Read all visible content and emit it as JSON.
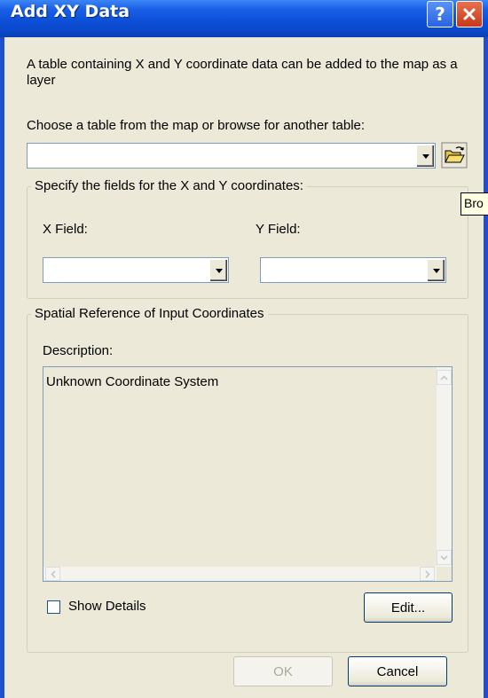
{
  "window": {
    "title": "Add XY Data"
  },
  "description": "A table containing X and Y coordinate data can be added to the map as a layer",
  "table_chooser": {
    "label": "Choose a table from the map or browse for another table:",
    "value": ""
  },
  "fields_group": {
    "legend": "Specify the fields for the X and Y coordinates:",
    "x_label": "X Field:",
    "y_label": "Y Field:",
    "x_value": "",
    "y_value": ""
  },
  "spatial_group": {
    "legend": "Spatial Reference of Input Coordinates",
    "description_label": "Description:",
    "description_text": "Unknown Coordinate System",
    "show_details_label": "Show Details",
    "show_details_checked": false,
    "edit_label": "Edit..."
  },
  "buttons": {
    "ok": "OK",
    "cancel": "Cancel"
  },
  "tooltip": {
    "text": "Bro"
  },
  "colors": {
    "title_bar": "#0a48cc",
    "dialog_bg": "#ece9d8",
    "close_button": "#c6391a"
  }
}
